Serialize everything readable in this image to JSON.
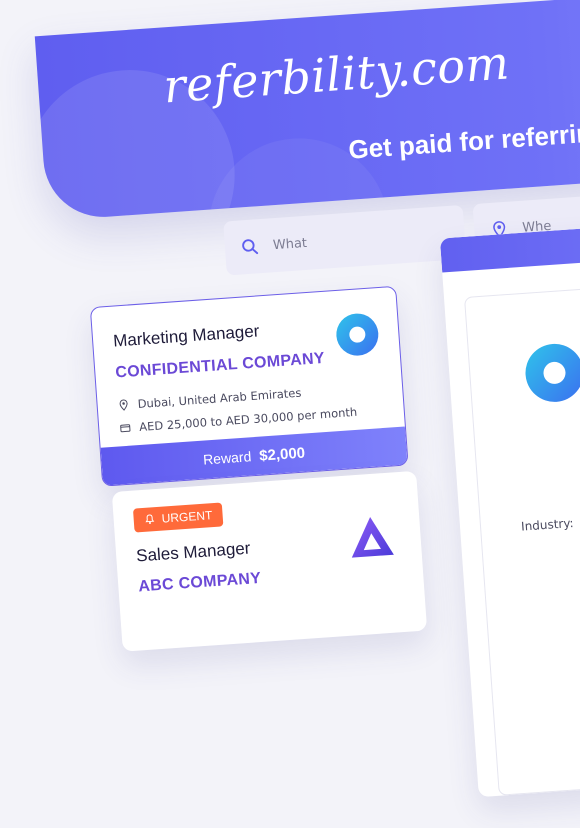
{
  "brand": {
    "logo_text": "referbility.com",
    "tagline": "Get paid for referring"
  },
  "search": {
    "what_placeholder": "What",
    "where_placeholder": "Whe"
  },
  "jobs": [
    {
      "title": "Marketing Manager",
      "company": "CONFIDENTIAL COMPANY",
      "location": "Dubai, United Arab Emirates",
      "salary": "AED 25,000 to AED 30,000 per month",
      "reward_label": "Reward",
      "reward_amount": "$2,000"
    },
    {
      "badge": "URGENT",
      "title": "Sales Manager",
      "company": "ABC COMPANY"
    }
  ],
  "detail_panel": {
    "industry_label": "Industry:"
  },
  "colors": {
    "primary": "#6467f2",
    "accent_purple": "#6b49d6",
    "urgent": "#ff6a3a",
    "logo_blue": "#2fc4ea"
  },
  "icons": [
    "search-icon",
    "location-pin-icon",
    "salary-icon",
    "bell-icon",
    "company-logo-ring",
    "company-logo-triangle"
  ]
}
